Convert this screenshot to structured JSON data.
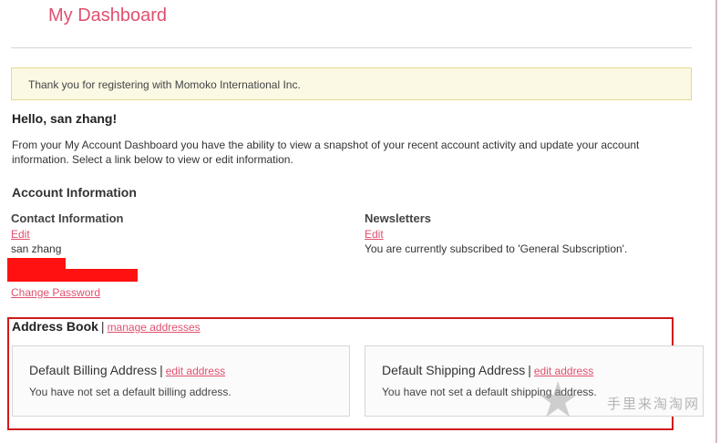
{
  "header": {
    "title": "My Dashboard"
  },
  "notice": {
    "text": "Thank you for registering with Momoko International Inc."
  },
  "greeting": "Hello, san zhang!",
  "intro": "From your My Account Dashboard you have the ability to view a snapshot of your recent account activity and update your account information. Select a link below to view or edit information.",
  "account_info": {
    "title": "Account Information",
    "contact": {
      "heading": "Contact Information",
      "edit_label": "Edit",
      "name": "san zhang",
      "change_password_label": "Change Password"
    },
    "newsletters": {
      "heading": "Newsletters",
      "edit_label": "Edit",
      "status": "You are currently subscribed to 'General Subscription'."
    }
  },
  "address_book": {
    "title": "Address Book",
    "separator": "|",
    "manage_label": "manage addresses",
    "billing": {
      "heading": "Default Billing Address",
      "edit_label": "edit address",
      "message": "You have not set a default billing address."
    },
    "shipping": {
      "heading": "Default Shipping Address",
      "edit_label": "edit address",
      "message": "You have not set a default shipping address."
    }
  },
  "watermark": {
    "text": "手里来淘淘网",
    "icon": "star-icon"
  },
  "colors": {
    "accent": "#e0506e",
    "notice_bg": "#fbf9e4",
    "notice_border": "#e6d98e",
    "highlight_frame": "#d11a1a",
    "redaction": "#ff1111"
  }
}
